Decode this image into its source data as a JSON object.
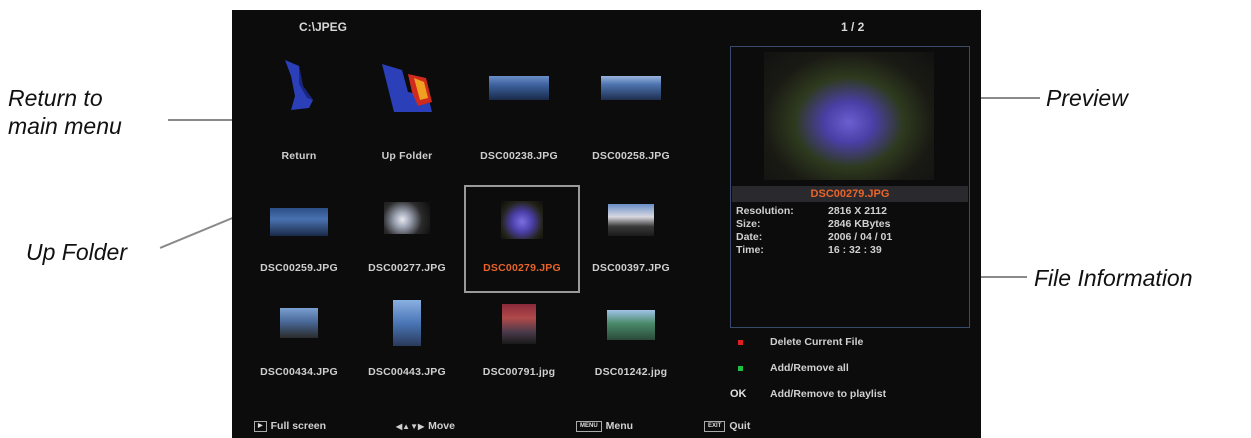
{
  "callouts": {
    "return_line1": "Return to",
    "return_line2": "main menu",
    "up_folder": "Up Folder",
    "preview": "Preview",
    "file_information": "File Information"
  },
  "header": {
    "path": "C:\\JPEG",
    "page_indicator": "1 / 2"
  },
  "grid": [
    {
      "label": "Return",
      "icon": "return-icon"
    },
    {
      "label": "Up Folder",
      "icon": "up-folder-icon"
    },
    {
      "label": "DSC00238.JPG",
      "icon": "photo-thumbnail"
    },
    {
      "label": "DSC00258.JPG",
      "icon": "photo-thumbnail"
    },
    {
      "label": "DSC00259.JPG",
      "icon": "photo-thumbnail"
    },
    {
      "label": "DSC00277.JPG",
      "icon": "photo-thumbnail"
    },
    {
      "label": "DSC00279.JPG",
      "icon": "photo-thumbnail",
      "selected": true
    },
    {
      "label": "DSC00397.JPG",
      "icon": "photo-thumbnail"
    },
    {
      "label": "DSC00434.JPG",
      "icon": "photo-thumbnail"
    },
    {
      "label": "DSC00443.JPG",
      "icon": "photo-thumbnail"
    },
    {
      "label": "DSC00791.jpg",
      "icon": "photo-thumbnail"
    },
    {
      "label": "DSC01242.jpg",
      "icon": "photo-thumbnail"
    }
  ],
  "preview": {
    "filename": "DSC00279.JPG",
    "info": [
      {
        "key": "Resolution:",
        "value": "2816 X 2112"
      },
      {
        "key": "Size:",
        "value": "2846 KBytes"
      },
      {
        "key": "Date:",
        "value": "2006 / 04 / 01"
      },
      {
        "key": "Time:",
        "value": "16 : 32 : 39"
      }
    ]
  },
  "legend": {
    "delete": "Delete Current File",
    "add_remove_all": "Add/Remove all",
    "ok_key": "OK",
    "add_remove_playlist": "Add/Remove to playlist"
  },
  "bottom": {
    "full_screen": "Full screen",
    "move": "Move",
    "menu_key": "MENU",
    "menu": "Menu",
    "exit_key": "EXIT",
    "quit": "Quit"
  },
  "colors": {
    "selected_text": "#e8642a",
    "delete_square": "#e02020",
    "add_square": "#20c040",
    "screen_bg": "#0c0c0c"
  }
}
